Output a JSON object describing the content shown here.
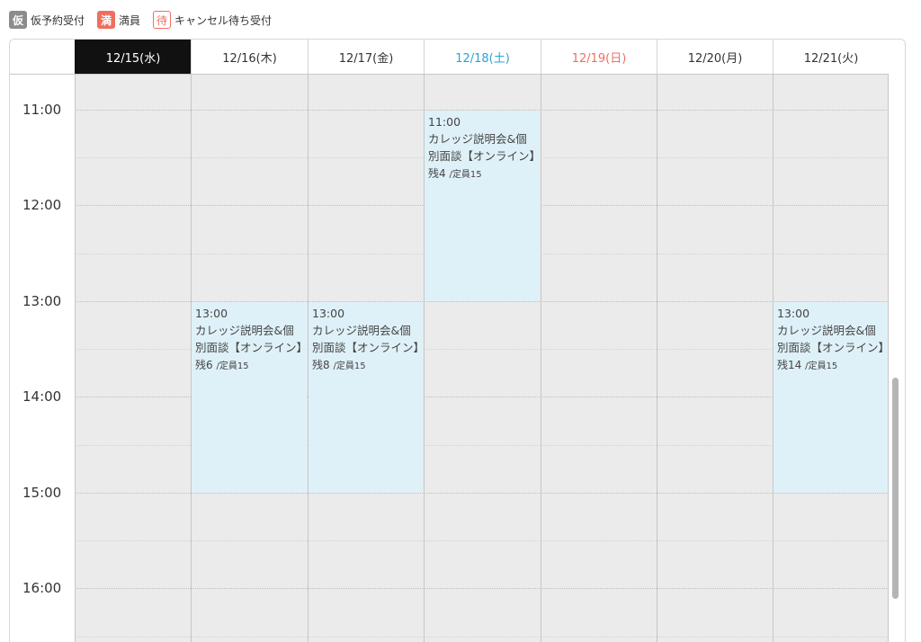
{
  "legend": [
    {
      "badge": "仮",
      "label": "仮予約受付",
      "icon": "provisional-icon"
    },
    {
      "badge": "満",
      "label": "満員",
      "icon": "full-icon"
    },
    {
      "badge": "待",
      "label": "キャンセル待ち受付",
      "icon": "waitlist-icon"
    }
  ],
  "days": [
    {
      "label": "12/15(水)",
      "type": "today"
    },
    {
      "label": "12/16(木)",
      "type": "weekday"
    },
    {
      "label": "12/17(金)",
      "type": "weekday"
    },
    {
      "label": "12/18(土)",
      "type": "saturday"
    },
    {
      "label": "12/19(日)",
      "type": "sunday"
    },
    {
      "label": "12/20(月)",
      "type": "weekday"
    },
    {
      "label": "12/21(火)",
      "type": "weekday"
    }
  ],
  "times": [
    "11:00",
    "12:00",
    "13:00",
    "14:00",
    "15:00",
    "16:00"
  ],
  "events": [
    {
      "day": "12/16(木)",
      "time": "13:00",
      "title": "カレッジ説明会&個別面談【オンライン】",
      "remaining": "残6",
      "capacity": "/定員15"
    },
    {
      "day": "12/17(金)",
      "time": "13:00",
      "title": "カレッジ説明会&個別面談【オンライン】",
      "remaining": "残8",
      "capacity": "/定員15"
    },
    {
      "day": "12/18(土)",
      "time": "11:00",
      "title": "カレッジ説明会&個別面談【オンライン】",
      "remaining": "残4",
      "capacity": "/定員15"
    },
    {
      "day": "12/21(火)",
      "time": "13:00",
      "title": "カレッジ説明会&個別面談【オンライン】",
      "remaining": "残14",
      "capacity": "/定員15"
    }
  ],
  "colors": {
    "today_bg": "#111111",
    "saturday": "#2ba3d4",
    "sunday": "#ef6f5e",
    "event_bg": "#dff1f8",
    "grid_bg": "#ebebeb"
  }
}
